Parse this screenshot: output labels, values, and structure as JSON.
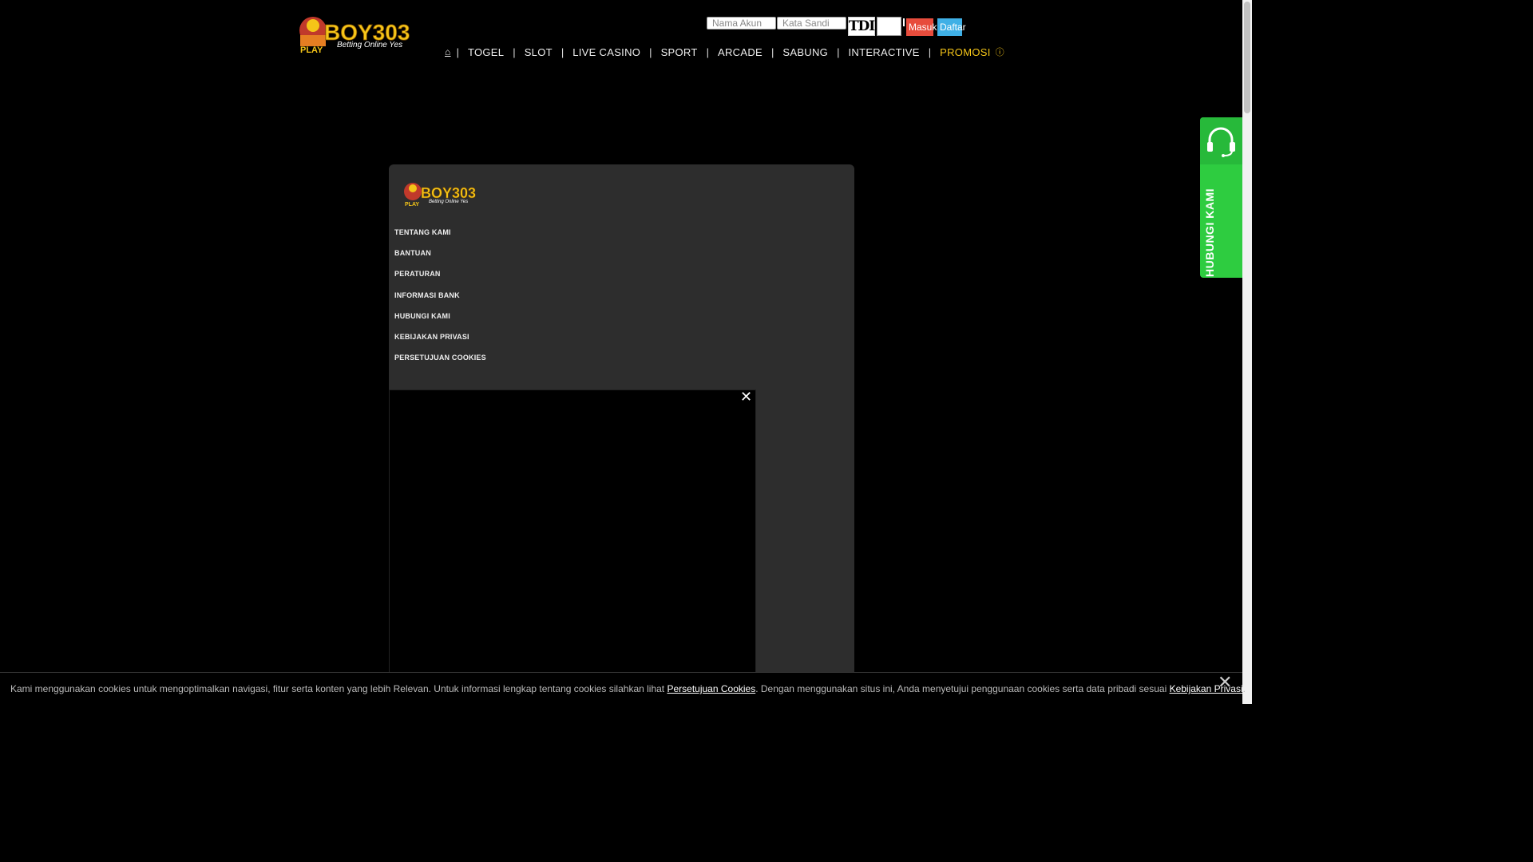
{
  "brand": {
    "logo_text": "BOY303",
    "tagline": "Betting Online Yes",
    "badge": "PLAY"
  },
  "login": {
    "username_placeholder": "Nama Akun",
    "password_placeholder": "Kata Sandi",
    "captcha_text": "TDI",
    "masuk_label": "Masuk",
    "daftar_label": "Daftar"
  },
  "nav": {
    "home": "⌂",
    "items": [
      "TOGEL",
      "SLOT",
      "LIVE CASINO",
      "SPORT",
      "ARCADE",
      "SABUNG",
      "INTERACTIVE"
    ],
    "promo": "PROMOSI",
    "separator": "|",
    "tail_icon": "ⓘ"
  },
  "footer": {
    "links": [
      "TENTANG KAMI",
      "BANTUAN",
      "PERATURAN",
      "INFORMASI BANK",
      "HUBUNGI KAMI",
      "KEBIJAKAN PRIVASI",
      "PERSETUJUAN COOKIES"
    ]
  },
  "video": {
    "close": "✕"
  },
  "side": {
    "label": "HUBUNGI KAMI",
    "icon": "headset-icon",
    "color": "#2ecc40"
  },
  "cookie": {
    "text_1": "Kami menggunakan cookies untuk mengoptimalkan navigasi, fitur serta konten yang lebih Relevan. Untuk informasi lengkap tentang cookies silahkan lihat ",
    "link_1": "Persetujuan Cookies",
    "text_2": ". Dengan menggunakan situs ini, Anda menyetujui penggunaan cookies serta data pribadi sesuai ",
    "link_2": "Kebijakan Privasi",
    "text_3": ".",
    "close": "✕"
  }
}
